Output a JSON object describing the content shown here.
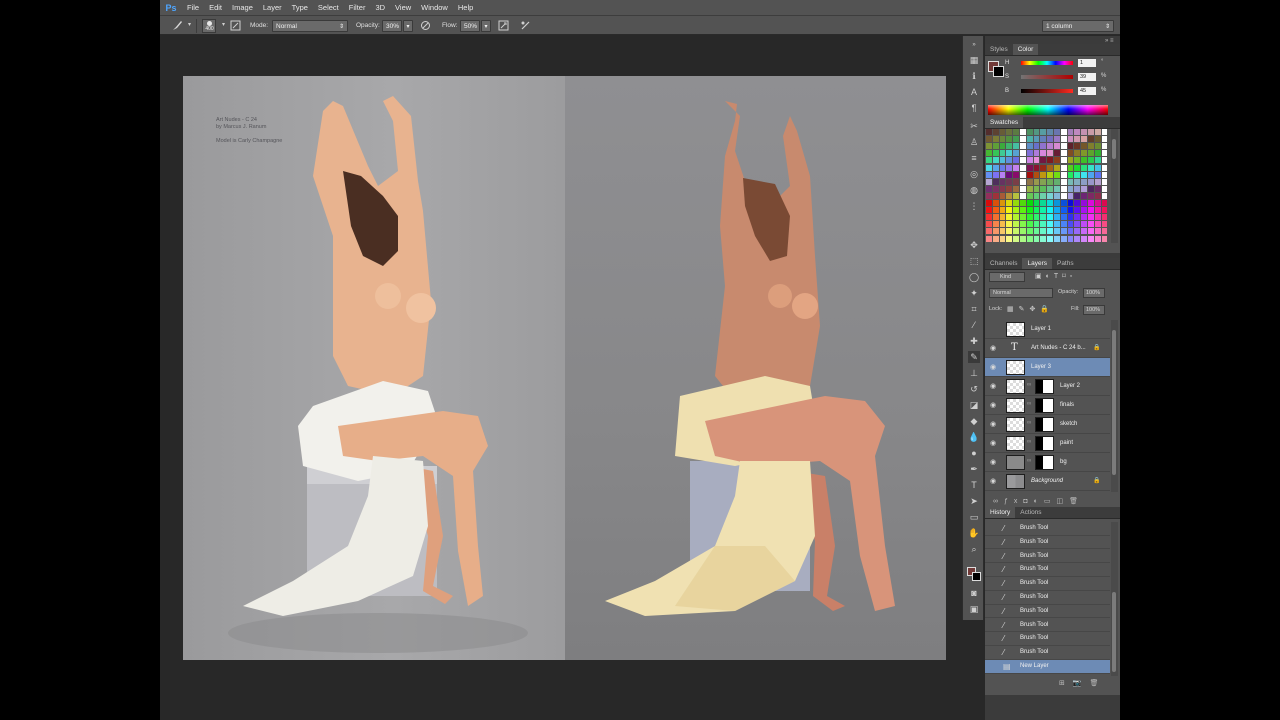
{
  "app": {
    "logo": "Ps"
  },
  "menu": [
    "File",
    "Edit",
    "Image",
    "Layer",
    "Type",
    "Select",
    "Filter",
    "3D",
    "View",
    "Window",
    "Help"
  ],
  "options": {
    "brush_size": "400",
    "mode_label": "Mode:",
    "mode_value": "Normal",
    "opacity_label": "Opacity:",
    "opacity_value": "30%",
    "flow_label": "Flow:",
    "flow_value": "50%",
    "workspace": "1 column"
  },
  "document": {
    "credit_line1": "Art Nudes - C 24",
    "credit_line2": "by Marcus J. Ranum",
    "credit_line3": "Model is Carly Champagne"
  },
  "color_panel": {
    "tabs": [
      "Styles",
      "Color"
    ],
    "active_tab": "Color",
    "h_label": "H",
    "h_value": "1",
    "s_label": "S",
    "s_value": "39",
    "b_label": "B",
    "b_value": "45",
    "unit_h": "°",
    "unit_s": "%",
    "unit_b": "%",
    "foreground": "#723a38"
  },
  "swatches_panel": {
    "tab": "Swatches"
  },
  "layers_panel": {
    "tabs": [
      "Channels",
      "Layers",
      "Paths"
    ],
    "active_tab": "Layers",
    "kind_label": "Kind",
    "blend_mode": "Normal",
    "opacity_label": "Opacity:",
    "opacity_value": "100%",
    "lock_label": "Lock:",
    "fill_label": "Fill:",
    "fill_value": "100%",
    "layers": [
      {
        "name": "Layer 1",
        "type": "pixel",
        "visible": false,
        "selected": false,
        "mask": false
      },
      {
        "name": "Art Nudes - C 24 b...",
        "type": "text",
        "visible": true,
        "selected": false,
        "mask": false
      },
      {
        "name": "Layer 3",
        "type": "pixel",
        "visible": true,
        "selected": true,
        "mask": false
      },
      {
        "name": "Layer 2",
        "type": "pixel",
        "visible": true,
        "selected": false,
        "mask": true
      },
      {
        "name": "finals",
        "type": "pixel",
        "visible": true,
        "selected": false,
        "mask": true
      },
      {
        "name": "sketch",
        "type": "pixel",
        "visible": true,
        "selected": false,
        "mask": true
      },
      {
        "name": "paint",
        "type": "pixel",
        "visible": true,
        "selected": false,
        "mask": true
      },
      {
        "name": "bg",
        "type": "gray",
        "visible": true,
        "selected": false,
        "mask": true
      },
      {
        "name": "Background",
        "type": "background",
        "visible": true,
        "selected": false,
        "mask": false
      }
    ]
  },
  "history_panel": {
    "tabs": [
      "History",
      "Actions"
    ],
    "active_tab": "History",
    "items": [
      {
        "label": "Brush Tool",
        "selected": false
      },
      {
        "label": "Brush Tool",
        "selected": false
      },
      {
        "label": "Brush Tool",
        "selected": false
      },
      {
        "label": "Brush Tool",
        "selected": false
      },
      {
        "label": "Brush Tool",
        "selected": false
      },
      {
        "label": "Brush Tool",
        "selected": false
      },
      {
        "label": "Brush Tool",
        "selected": false
      },
      {
        "label": "Brush Tool",
        "selected": false
      },
      {
        "label": "Brush Tool",
        "selected": false
      },
      {
        "label": "Brush Tool",
        "selected": false
      },
      {
        "label": "New Layer",
        "selected": true
      }
    ]
  }
}
